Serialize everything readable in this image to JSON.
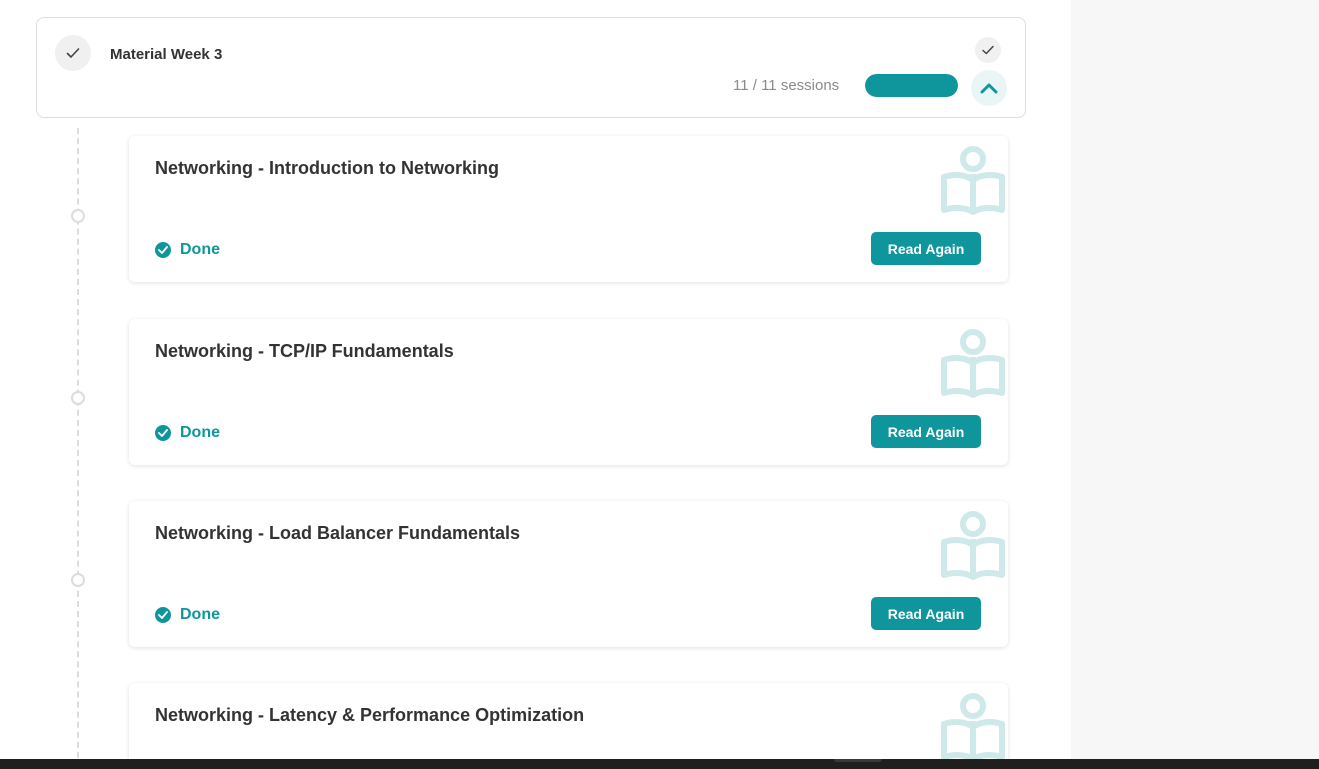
{
  "week": {
    "title": "Material Week 3",
    "sessions_text": "11 / 11 sessions",
    "progress": 1.0,
    "expanded": true
  },
  "sessions": [
    {
      "title": "Networking - Introduction to Networking",
      "status": "Done",
      "action": "Read Again"
    },
    {
      "title": "Networking - TCP/IP Fundamentals",
      "status": "Done",
      "action": "Read Again"
    },
    {
      "title": "Networking - Load Balancer Fundamentals",
      "status": "Done",
      "action": "Read Again"
    },
    {
      "title": "Networking - Latency & Performance Optimization",
      "status": "",
      "action": ""
    }
  ],
  "icons": {
    "week_status": "check-icon",
    "week_complete": "check-icon",
    "collapse": "chevron-up-icon",
    "session_type": "reading-book-icon",
    "session_status": "check-circle-icon"
  },
  "colors": {
    "accent": "#0f969c",
    "icon_light": "#cfe9ea",
    "muted_text": "#8a8a8a"
  }
}
